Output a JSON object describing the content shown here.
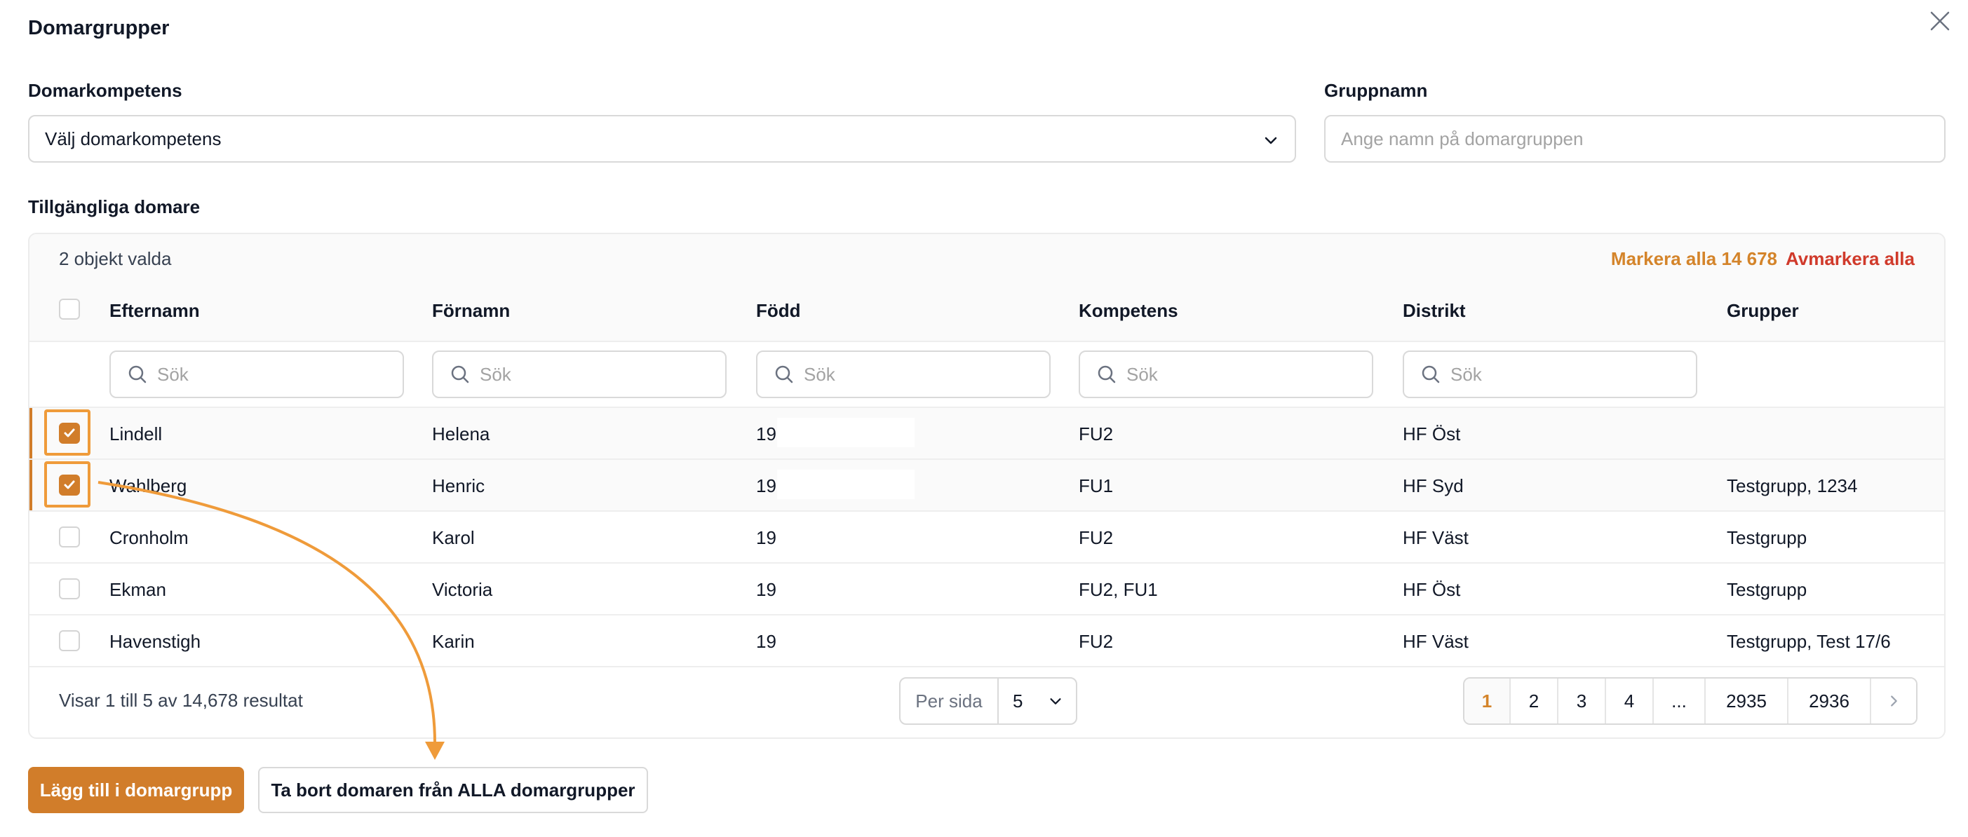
{
  "modal": {
    "title": "Domargrupper",
    "close_icon": "close-icon"
  },
  "form": {
    "competence_label": "Domarkompetens",
    "competence_value": "Välj domarkompetens",
    "group_name_label": "Gruppnamn",
    "group_name_placeholder": "Ange namn på domargruppen",
    "group_name_value": ""
  },
  "table": {
    "section_label": "Tillgängliga domare",
    "selected_count": "2 objekt valda",
    "select_all": "Markera alla 14 678",
    "deselect_all": "Avmarkera alla",
    "columns": [
      "Efternamn",
      "Förnamn",
      "Född",
      "Kompetens",
      "Distrikt",
      "Grupper"
    ],
    "search_placeholder": "Sök",
    "rows": [
      {
        "checked": true,
        "efternamn": "Lindell",
        "fornamn": "Helena",
        "fodd": "19",
        "kompetens": "FU2",
        "distrikt": "HF Öst",
        "grupper": ""
      },
      {
        "checked": true,
        "efternamn": "Wahlberg",
        "fornamn": "Henric",
        "fodd": "19",
        "kompetens": "FU1",
        "distrikt": "HF Syd",
        "grupper": "Testgrupp, 1234"
      },
      {
        "checked": false,
        "efternamn": "Cronholm",
        "fornamn": "Karol",
        "fodd": "19",
        "kompetens": "FU2",
        "distrikt": "HF Väst",
        "grupper": "Testgrupp"
      },
      {
        "checked": false,
        "efternamn": "Ekman",
        "fornamn": "Victoria",
        "fodd": "19",
        "kompetens": "FU2, FU1",
        "distrikt": "HF Öst",
        "grupper": "Testgrupp"
      },
      {
        "checked": false,
        "efternamn": "Havenstigh",
        "fornamn": "Karin",
        "fodd": "19",
        "kompetens": "FU2",
        "distrikt": "HF Väst",
        "grupper": "Testgrupp, Test 17/6"
      }
    ],
    "result_text": "Visar 1 till 5 av 14,678 resultat",
    "per_page_label": "Per sida",
    "per_page_value": "5",
    "pages": [
      "1",
      "2",
      "3",
      "4",
      "...",
      "2935",
      "2936"
    ],
    "active_page": "1",
    "next_icon": "chevron-right-icon"
  },
  "actions": {
    "add_label": "Lägg till i domargrupp",
    "remove_label": "Ta bort domaren från ALLA domargrupper"
  },
  "colors": {
    "accent": "#d17d2a",
    "danger": "#d03a2b",
    "highlight": "#ef9b3a"
  }
}
